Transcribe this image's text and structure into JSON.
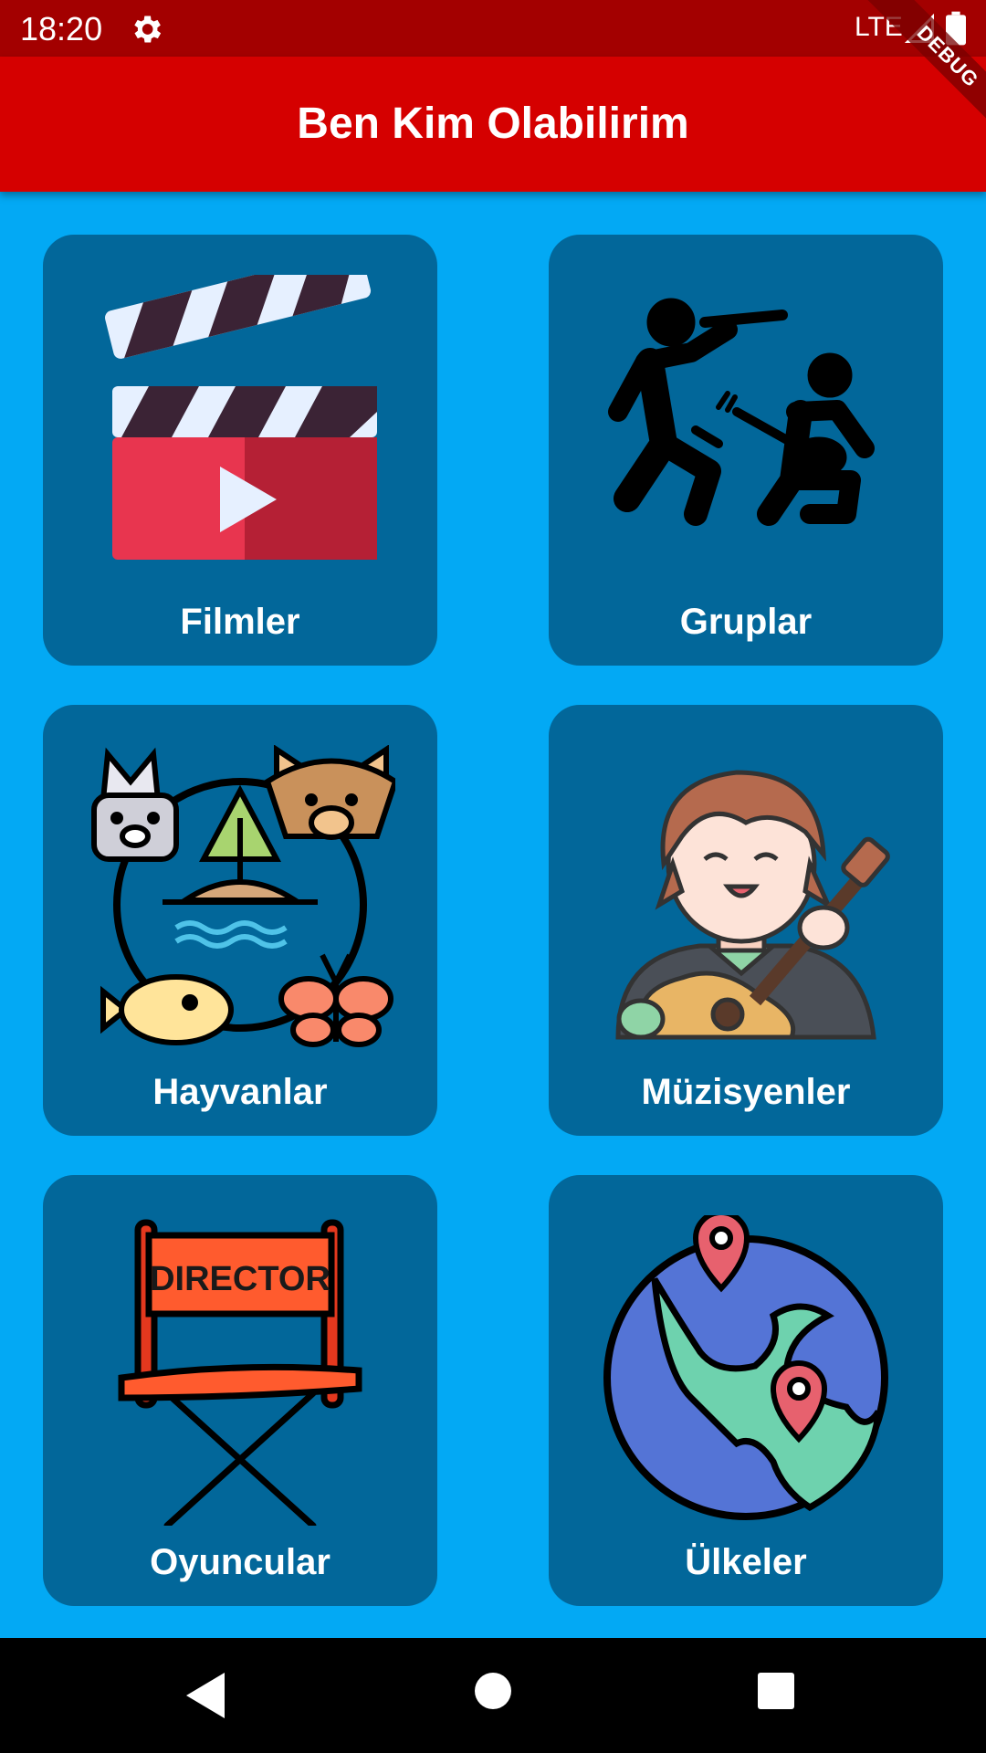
{
  "status_bar": {
    "time": "18:20",
    "network": "LTE",
    "icons": [
      "settings-icon",
      "signal-icon",
      "battery-icon"
    ]
  },
  "debug_banner": "DEBUG",
  "app_bar": {
    "title": "Ben Kim Olabilirim"
  },
  "categories": [
    {
      "label": "Filmler",
      "icon": "clapperboard-icon"
    },
    {
      "label": "Gruplar",
      "icon": "band-icon"
    },
    {
      "label": "Hayvanlar",
      "icon": "animals-icon"
    },
    {
      "label": "Müzisyenler",
      "icon": "guitarist-icon"
    },
    {
      "label": "Oyuncular",
      "icon": "director-chair-icon",
      "icon_text": "DIRECTOR"
    },
    {
      "label": "Ülkeler",
      "icon": "globe-icon"
    }
  ],
  "nav_bar": {
    "icons": [
      "back-icon",
      "home-icon",
      "recents-icon"
    ]
  },
  "colors": {
    "background": "#03A9F4",
    "app_bar": "#D50000",
    "status_bar": "#A30000",
    "card": "#02679A"
  }
}
